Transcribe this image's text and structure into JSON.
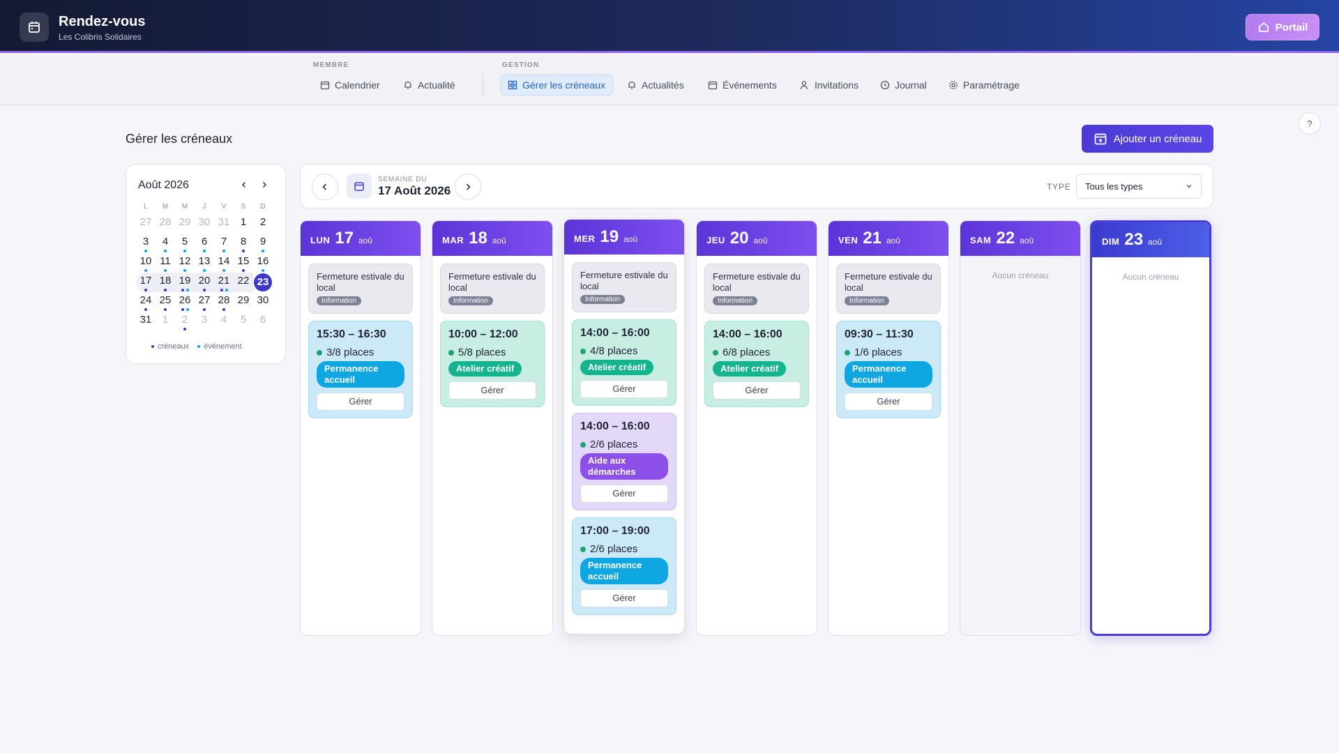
{
  "header": {
    "title": "Rendez-vous",
    "subtitle": "Les Colibris Solidaires",
    "portal_label": "Portail"
  },
  "nav": {
    "group_member": "MEMBRE",
    "group_admin": "GESTION",
    "items": [
      "Calendrier",
      "Actualité",
      "Gérer les créneaux",
      "Actualités",
      "Événements",
      "Invitations",
      "Journal",
      "Paramétrage"
    ]
  },
  "help_label": "?",
  "page": {
    "title": "Gérer les créneaux",
    "add_button": "Ajouter un créneau"
  },
  "mini_calendar": {
    "title": "Août 2026",
    "dow": [
      "L",
      "M",
      "M",
      "J",
      "V",
      "S",
      "D"
    ],
    "weeks": [
      [
        "27",
        "28",
        "29",
        "30",
        "31",
        "1",
        "2"
      ],
      [
        "3",
        "4",
        "5",
        "6",
        "7",
        "8",
        "9"
      ],
      [
        "10",
        "11",
        "12",
        "13",
        "14",
        "15",
        "16"
      ],
      [
        "17",
        "18",
        "19",
        "20",
        "21",
        "22",
        "23"
      ],
      [
        "24",
        "25",
        "26",
        "27",
        "28",
        "29",
        "30"
      ],
      [
        "31",
        "1",
        "2",
        "3",
        "4",
        "5",
        "6"
      ]
    ],
    "legend_slots": "créneaux",
    "legend_events": "événement"
  },
  "week": {
    "label": "SEMAINE DU",
    "date": "17 Août 2026",
    "type_label": "TYPE",
    "type_value": "Tous les types"
  },
  "closure": {
    "title": "Fermeture estivale du local",
    "tag": "Information"
  },
  "empty_text": "Aucun créneau",
  "manage_label": "Gérer",
  "days": [
    {
      "dow": "LUN",
      "num": "17",
      "mon": "aoû",
      "slots": [
        {
          "time": "15:30 – 16:30",
          "places": "3/8 places",
          "tag": "Permanence accueil"
        }
      ]
    },
    {
      "dow": "MAR",
      "num": "18",
      "mon": "aoû",
      "slots": [
        {
          "time": "10:00 – 12:00",
          "places": "5/8 places",
          "tag": "Atelier créatif"
        }
      ]
    },
    {
      "dow": "MER",
      "num": "19",
      "mon": "aoû",
      "slots": [
        {
          "time": "14:00 – 16:00",
          "places": "4/8 places",
          "tag": "Atelier créatif"
        },
        {
          "time": "14:00 – 16:00",
          "places": "2/6 places",
          "tag": "Aide aux démarches"
        },
        {
          "time": "17:00 – 19:00",
          "places": "2/6 places",
          "tag": "Permanence accueil"
        }
      ]
    },
    {
      "dow": "JEU",
      "num": "20",
      "mon": "aoû",
      "slots": [
        {
          "time": "14:00 – 16:00",
          "places": "6/8 places",
          "tag": "Atelier créatif"
        }
      ]
    },
    {
      "dow": "VEN",
      "num": "21",
      "mon": "aoû",
      "slots": [
        {
          "time": "09:30 – 11:30",
          "places": "1/6 places",
          "tag": "Permanence accueil"
        }
      ]
    },
    {
      "dow": "SAM",
      "num": "22",
      "mon": "aoû",
      "slots": []
    },
    {
      "dow": "DIM",
      "num": "23",
      "mon": "aoû",
      "slots": []
    }
  ],
  "colors": {
    "accent": "#4a3ad6",
    "header_purple": "#6b40e3",
    "slot_blue": "#0fa7e2",
    "slot_green": "#14b58e",
    "slot_purple": "#8c4fe8",
    "dot_slot": "#3f37c9",
    "dot_event": "#0fa7e2"
  }
}
